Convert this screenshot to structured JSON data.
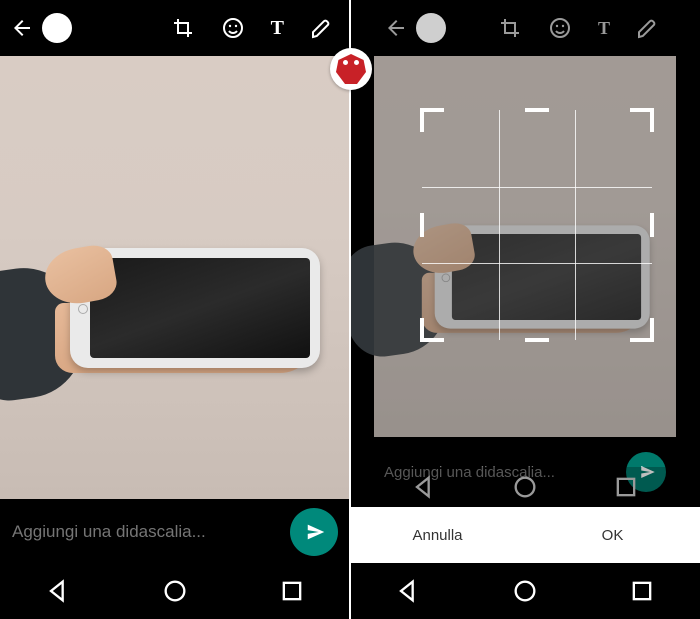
{
  "colors": {
    "accent": "#00897b",
    "logo": "#c82127"
  },
  "left": {
    "caption_placeholder": "Aggiungi una didascalia...",
    "toolbar": {
      "back": "back",
      "crop": "crop",
      "emoji": "emoji",
      "text": "T",
      "draw": "draw"
    }
  },
  "right": {
    "caption_placeholder": "Aggiungi una didascalia...",
    "crop_dialog": {
      "cancel_label": "Annulla",
      "ok_label": "OK"
    }
  },
  "nav": {
    "back": "back",
    "home": "home",
    "recent": "recent"
  }
}
